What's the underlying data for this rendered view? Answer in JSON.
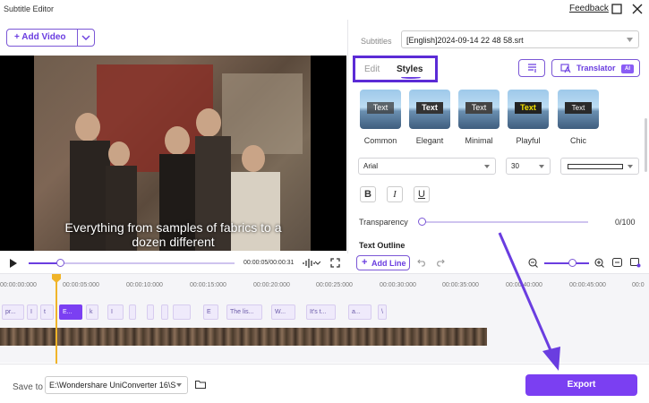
{
  "app": {
    "title": "Subtitle Editor",
    "feedback": "Feedback"
  },
  "left": {
    "add_video": "Add Video",
    "subtitle_line1": "Everything from samples of fabrics to a",
    "subtitle_line2": "dozen different",
    "time": "00:00:05/00:00:31",
    "progress": 0.15
  },
  "panel": {
    "subtitles_label": "Subtitles",
    "subtitles_file": "[English]2024-09-14 22 48 58.srt",
    "tabs": [
      "Edit",
      "Styles"
    ],
    "translator": "Translator",
    "ai_badge": "AI",
    "presets": [
      {
        "name": "Common",
        "sample": "Text"
      },
      {
        "name": "Elegant",
        "sample": "Text"
      },
      {
        "name": "Minimal",
        "sample": "Text"
      },
      {
        "name": "Playful",
        "sample": "Text"
      },
      {
        "name": "Chic",
        "sample": "Text"
      }
    ],
    "font": "Arial",
    "size": "30",
    "format": [
      "B",
      "I",
      "U"
    ],
    "transparency_label": "Transparency",
    "transparency_value": "0/100",
    "transparency_level": 0,
    "outline_label": "Text Outline",
    "add_line": "Add Line"
  },
  "timeline": {
    "ticks": [
      "00:00:00:000",
      "00:00:05:000",
      "00:00:10:000",
      "00:00:15:000",
      "00:00:20:000",
      "00:00:25:000",
      "00:00:30:000",
      "00:00:35:000",
      "00:00:40:000",
      "00:00:45:000",
      "00:0"
    ],
    "clips": [
      "pr...",
      "I",
      "t",
      "E...",
      "k",
      "I",
      "",
      "",
      "",
      "",
      "E",
      "The lis...",
      "W...",
      "It's t...",
      "a...",
      "\\"
    ]
  },
  "bottom": {
    "save_to_label": "Save to",
    "save_path": "E:\\Wondershare UniConverter 16\\S",
    "export": "Export"
  },
  "colors": {
    "accent": "#7b3ff2",
    "highlight_box": "#5b2bd6",
    "playhead": "#f0b429"
  }
}
